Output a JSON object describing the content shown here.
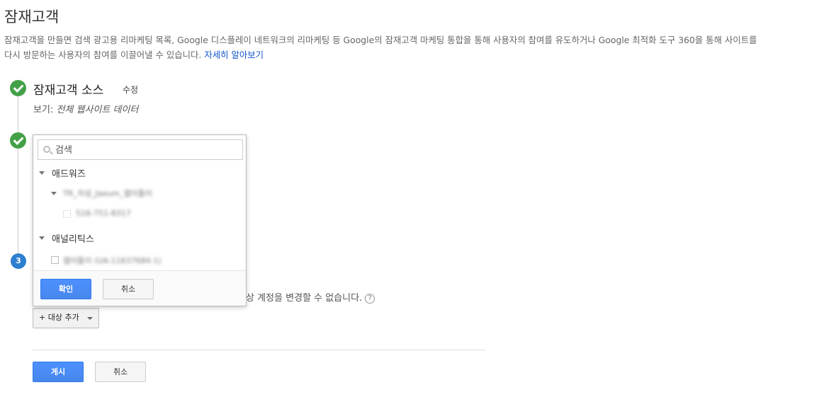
{
  "page": {
    "title": "잠재고객",
    "intro_line1": "잠재고객을 만들면 검색 광고용 리마케팅 목록, Google 디스플레이 네트워크의 리마케팅 등 Google의 잠재고객 마케팅 통합을 통해 사용자의 참여를 유도하거나 Google 최적화 도구 360을 통해 사이트를",
    "intro_line2": "다시 방문하는 사용자의 참여를 이끌어낼 수 있습니다.",
    "learn_more": "자세히 알아보기"
  },
  "steps": {
    "step1": {
      "title": "잠재고객 소스",
      "edit": "수정",
      "view_prefix": "보기: ",
      "view_value": "전체 웹사이트 데이터"
    },
    "step3_number": "3",
    "behind_text": "상 계정을 변경할 수 없습니다.",
    "help_icon": "?",
    "add_target": "+ 대상 추가"
  },
  "dropdown": {
    "search_placeholder": "검색",
    "groups": [
      {
        "label": "애드워즈",
        "account": "TR_자성_Jaeum_웹이틀이",
        "sub_account": "516-751-8317"
      },
      {
        "label": "애널리틱스",
        "property": "웹이틀이 (UA-11637684-1)"
      }
    ],
    "ok": "확인",
    "cancel": "취소"
  },
  "footer": {
    "publish": "게시",
    "cancel": "취소"
  },
  "colors": {
    "primary": "#4d90fe",
    "success": "#43a047",
    "step_blue": "#2d7fd0",
    "link": "#1155cc"
  }
}
